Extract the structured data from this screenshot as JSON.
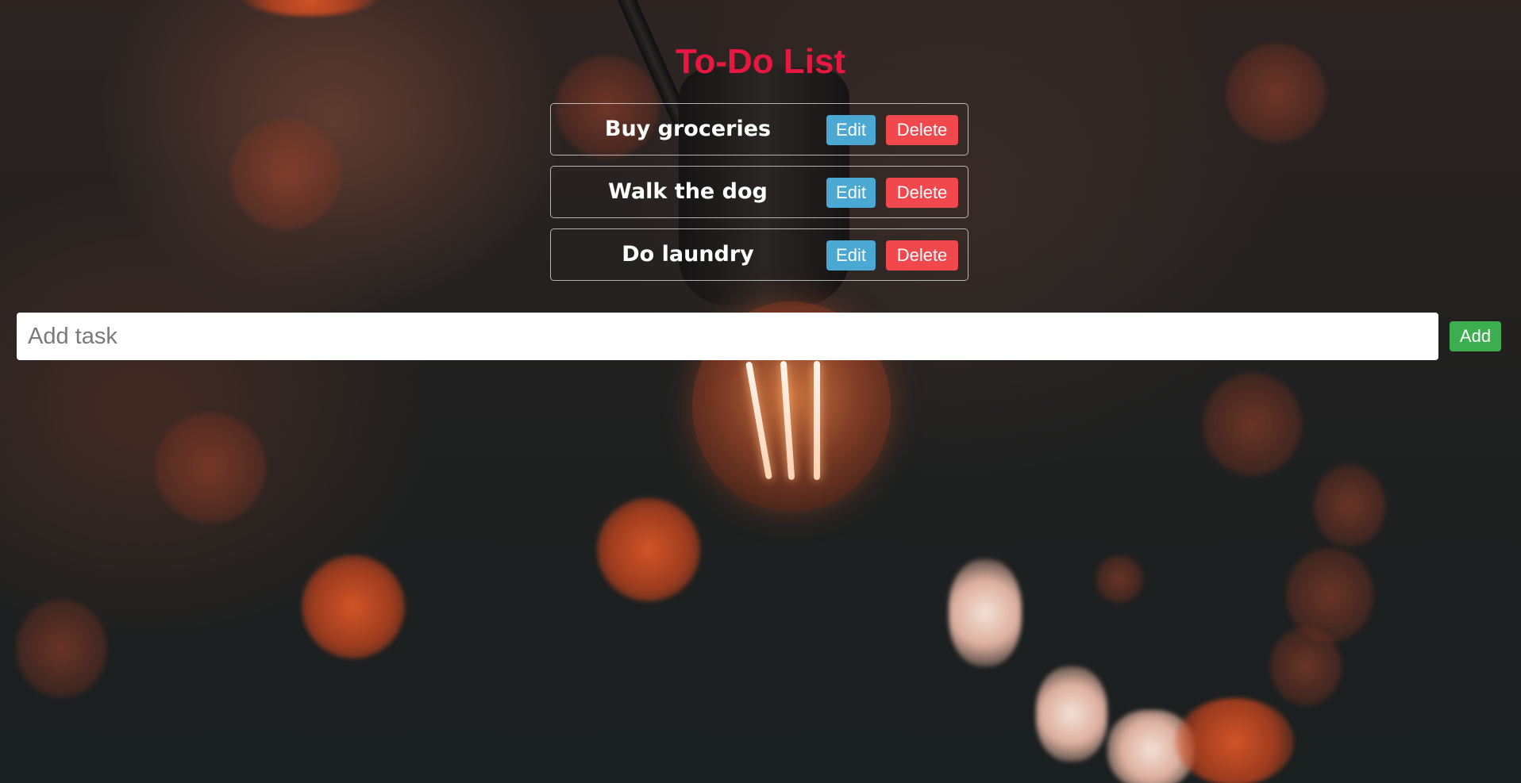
{
  "page": {
    "title": "To-Do List",
    "title_color": "#e8173f"
  },
  "tasks": [
    {
      "text": "Buy groceries",
      "edit_label": "Edit",
      "delete_label": "Delete"
    },
    {
      "text": "Walk the dog",
      "edit_label": "Edit",
      "delete_label": "Delete"
    },
    {
      "text": "Do laundry",
      "edit_label": "Edit",
      "delete_label": "Delete"
    }
  ],
  "add_task": {
    "placeholder": "Add task",
    "value": "",
    "button_label": "Add"
  },
  "colors": {
    "edit_button": "#4aa8d2",
    "delete_button": "#f0484d",
    "add_button": "#3cae50",
    "task_text": "#ffffff"
  }
}
